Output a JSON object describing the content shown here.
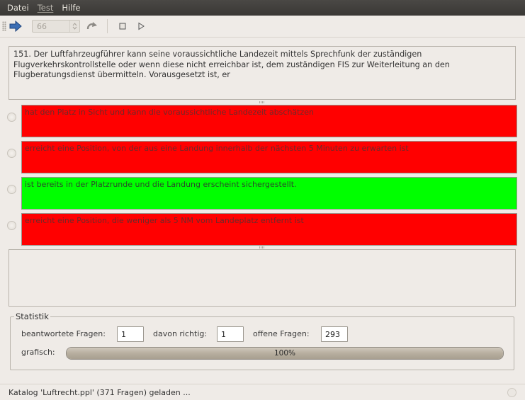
{
  "menu": [
    "Datei",
    "Test",
    "Hilfe"
  ],
  "toolbar": {
    "question_number": "66",
    "icons": [
      "arrow-right-icon",
      "redo-icon",
      "stop-icon",
      "play-icon"
    ]
  },
  "question": {
    "text": "151. Der Luftfahrzeugführer kann seine voraussichtliche Landezeit mittels Sprechfunk der zuständigen Flugverkehrskontrollstelle oder wenn diese nicht erreichbar ist, dem zuständigen FIS zur Weiterleitung an den Flugberatungsdienst übermitteln. Vorausgesetzt ist, er"
  },
  "answers": [
    {
      "text": "hat den Platz in Sicht und kann die voraussichtliche Landezeit abschätzen",
      "state": "wrong",
      "color": "#ff0000"
    },
    {
      "text": "erreicht eine Position, von der aus eine Landung innerhalb der nächsten 5 Minuten zu erwarten ist",
      "state": "wrong",
      "color": "#ff0000"
    },
    {
      "text": "ist bereits in der Platzrunde und die Landung erscheint sichergestellt.",
      "state": "right",
      "color": "#00ff00"
    },
    {
      "text": "erreicht eine Position, die weniger als 5 NM vom Landeplatz entfernt ist",
      "state": "wrong",
      "color": "#ff0000"
    }
  ],
  "explanation": "",
  "stats": {
    "legend": "Statistik",
    "answered_label": "beantwortete Fragen:",
    "answered_value": "1",
    "correct_label": "davon richtig:",
    "correct_value": "1",
    "open_label": "offene Fragen:",
    "open_value": "293",
    "graphic_label": "grafisch:",
    "progress_text": "100%",
    "progress_fraction": 1.0
  },
  "status": {
    "text": "Katalog 'Luftrecht.ppl' (371 Fragen) geladen ..."
  }
}
